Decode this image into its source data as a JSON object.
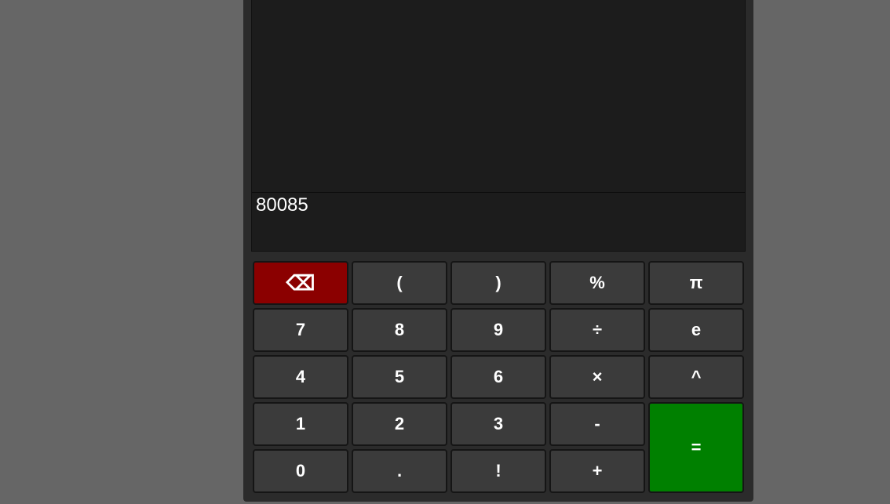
{
  "display": {
    "history": "",
    "input": "80085"
  },
  "keys": {
    "backspace": "⌫",
    "open_paren": "(",
    "close_paren": ")",
    "percent": "%",
    "pi": "π",
    "seven": "7",
    "eight": "8",
    "nine": "9",
    "divide": "÷",
    "e": "e",
    "four": "4",
    "five": "5",
    "six": "6",
    "multiply": "×",
    "power": "^",
    "one": "1",
    "two": "2",
    "three": "3",
    "minus": "-",
    "equals": "=",
    "zero": "0",
    "decimal": ".",
    "factorial": "!",
    "plus": "+"
  },
  "colors": {
    "backspace": "#8b0000",
    "equals": "#008000",
    "key": "#3b3b3b",
    "display": "#1c1c1c",
    "background": "#666666"
  }
}
